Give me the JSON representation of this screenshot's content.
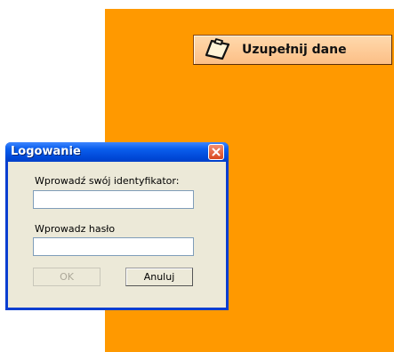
{
  "main": {
    "fill_button_label": "Uzupełnij dane",
    "fill_button_icon": "clipboard-icon",
    "accent_color": "#ff9900"
  },
  "dialog": {
    "title": "Logowanie",
    "close_icon": "close-icon",
    "id_label": "Wprowadź swój identyfikator:",
    "id_value": "",
    "password_label": "Wprowadz hasło",
    "password_value": "",
    "ok_label": "OK",
    "cancel_label": "Anuluj"
  }
}
